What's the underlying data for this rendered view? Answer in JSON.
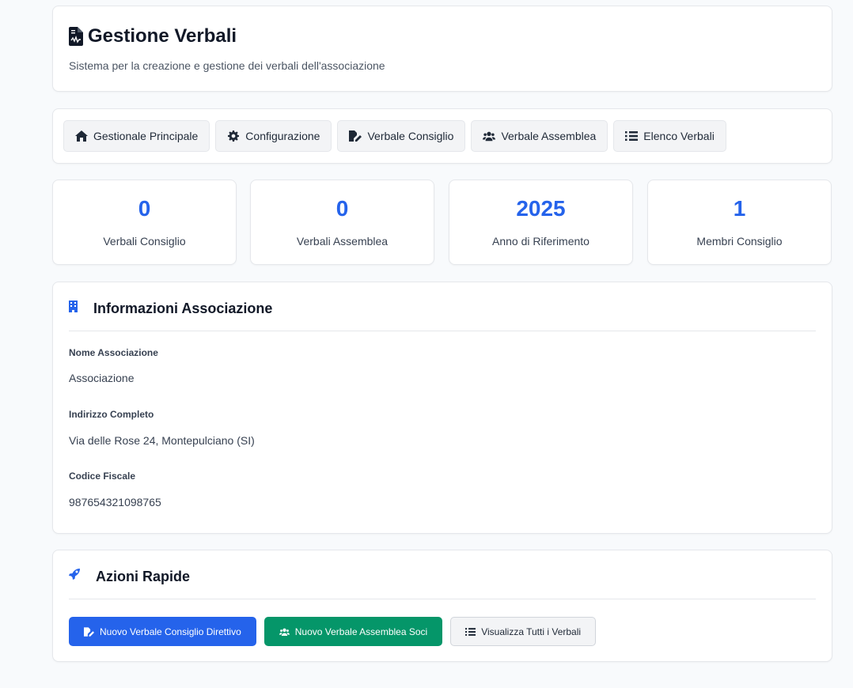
{
  "header": {
    "title": "Gestione Verbali",
    "subtitle": "Sistema per la creazione e gestione dei verbali dell'associazione",
    "icon": "file-document-icon"
  },
  "nav": {
    "items": [
      {
        "label": "Gestionale Principale",
        "icon": "home-icon"
      },
      {
        "label": "Configurazione",
        "icon": "gear-icon"
      },
      {
        "label": "Verbale Consiglio",
        "icon": "file-signature-icon"
      },
      {
        "label": "Verbale Assemblea",
        "icon": "users-icon"
      },
      {
        "label": "Elenco Verbali",
        "icon": "list-icon"
      }
    ]
  },
  "stats": [
    {
      "value": "0",
      "label": "Verbali Consiglio"
    },
    {
      "value": "0",
      "label": "Verbali Assemblea"
    },
    {
      "value": "2025",
      "label": "Anno di Riferimento"
    },
    {
      "value": "1",
      "label": "Membri Consiglio"
    }
  ],
  "info": {
    "title": "Informazioni Associazione",
    "icon": "building-icon",
    "fields": [
      {
        "label": "Nome Associazione",
        "value": "Associazione"
      },
      {
        "label": "Indirizzo Completo",
        "value": "Via delle Rose 24, Montepulciano (SI)"
      },
      {
        "label": "Codice Fiscale",
        "value": "987654321098765"
      }
    ]
  },
  "actions": {
    "title": "Azioni Rapide",
    "icon": "rocket-icon",
    "buttons": [
      {
        "label": "Nuovo Verbale Consiglio Direttivo",
        "icon": "file-signature-icon"
      },
      {
        "label": "Nuovo Verbale Assemblea Soci",
        "icon": "users-icon"
      },
      {
        "label": "Visualizza Tutti i Verbali",
        "icon": "list-icon"
      }
    ]
  },
  "colors": {
    "primary": "#2563eb",
    "success": "#059669",
    "background": "#f8fafc"
  }
}
